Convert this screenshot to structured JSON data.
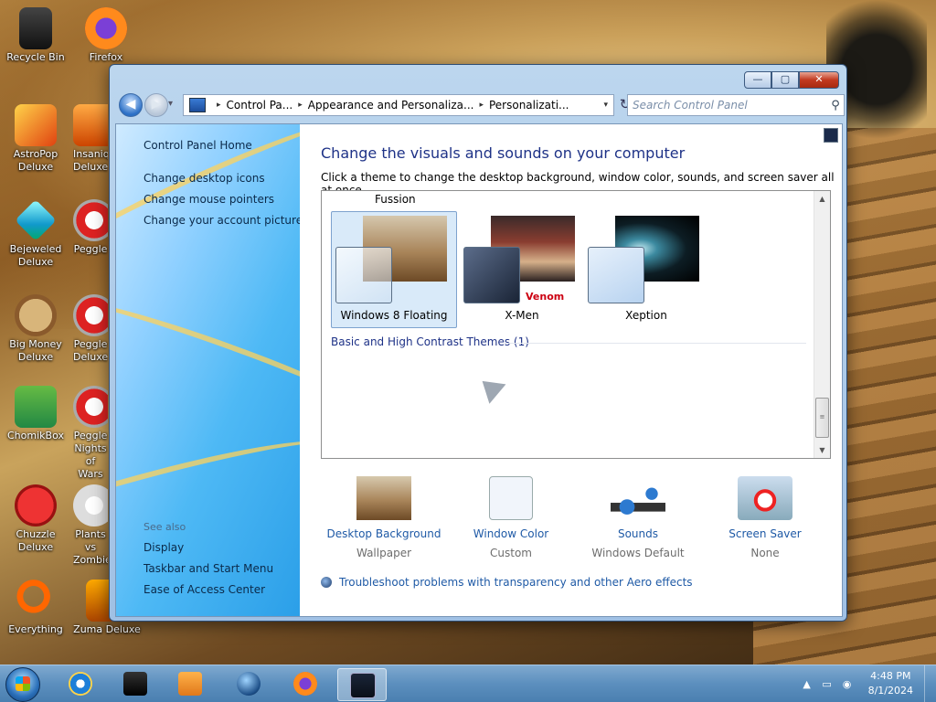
{
  "desktop": {
    "icons": [
      {
        "label": "Recycle Bin"
      },
      {
        "label": "Firefox"
      },
      {
        "label": "AstroPop Deluxe"
      },
      {
        "label": "Insaniquarium Deluxe"
      },
      {
        "label": "Bejeweled Deluxe"
      },
      {
        "label": "Peggle"
      },
      {
        "label": "Big Money Deluxe"
      },
      {
        "label": "Peggle Deluxe"
      },
      {
        "label": "ChomikBox"
      },
      {
        "label": "Peggle Nights of Wars"
      },
      {
        "label": "Chuzzle Deluxe"
      },
      {
        "label": "Plants vs Zombies"
      },
      {
        "label": "Everything"
      },
      {
        "label": "Zuma Deluxe"
      }
    ]
  },
  "window": {
    "buttons": {
      "minimize": "—",
      "maximize": "▢",
      "close": "✕"
    },
    "nav": {
      "back": "◀",
      "forward": "▶",
      "dropdown": "▾",
      "refresh": "↻"
    },
    "breadcrumb": [
      "Control Pa...",
      "Appearance and Personaliza...",
      "Personalizati..."
    ],
    "breadcrumb_sep": "▸",
    "search_placeholder": "Search Control Panel",
    "search_icon": "⚲",
    "sidebar": {
      "home": "Control Panel Home",
      "links": [
        "Change desktop icons",
        "Change mouse pointers",
        "Change your account picture"
      ],
      "see_also": "See also",
      "see_also_links": [
        "Display",
        "Taskbar and Start Menu",
        "Ease of Access Center"
      ]
    },
    "main": {
      "title": "Change the visuals and sounds on your computer",
      "subtitle": "Click a theme to change the desktop background, window color, sounds, and screen saver all at once.",
      "partial_theme_label": "Fussion",
      "themes": [
        {
          "name": "Windows 8 Floating",
          "selected": true
        },
        {
          "name": "X-Men",
          "selected": false
        },
        {
          "name": "Xeption",
          "selected": false
        }
      ],
      "xmen_logo_text": "Venom",
      "group_label": "Basic and High Contrast Themes (1)",
      "scroll_arrows": {
        "up": "▲",
        "down": "▼",
        "grip": "≡"
      },
      "quick_settings": [
        {
          "label": "Desktop Background",
          "value": "Wallpaper",
          "icon": "desktop-background-icon"
        },
        {
          "label": "Window Color",
          "value": "Custom",
          "icon": "window-color-icon"
        },
        {
          "label": "Sounds",
          "value": "Windows Default",
          "icon": "sounds-icon"
        },
        {
          "label": "Screen Saver",
          "value": "None",
          "icon": "screen-saver-icon"
        }
      ],
      "troubleshoot_link": "Troubleshoot problems with transparency and other Aero effects"
    }
  },
  "taskbar": {
    "apps": [
      "internet-explorer",
      "recycle-bin",
      "media-player",
      "globe",
      "firefox",
      "control-panel"
    ],
    "active_app": "control-panel",
    "tray_icons": {
      "arrow": "▲",
      "network": "▭",
      "volume": "◉"
    },
    "time": "4:48 PM",
    "date": "8/1/2024"
  }
}
